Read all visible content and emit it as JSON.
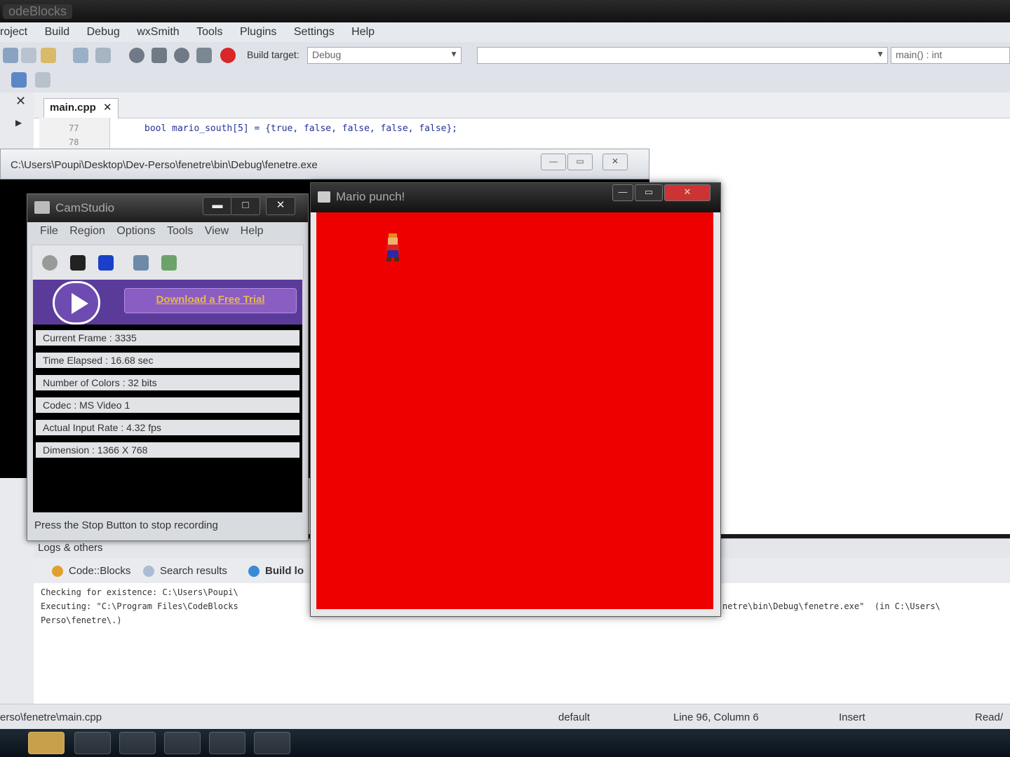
{
  "ide": {
    "title": "odeBlocks",
    "menu": [
      "roject",
      "Build",
      "Debug",
      "wxSmith",
      "Tools",
      "Plugins",
      "Settings",
      "Help"
    ],
    "build_target_label": "Build target:",
    "build_target_value": "Debug",
    "symbol_combo": "main() : int",
    "file_tab": "main.cpp",
    "line_numbers": [
      "77",
      "78"
    ],
    "code_line": "bool mario_south[5] = {true, false, false, false, false};"
  },
  "console": {
    "path": "C:\\Users\\Poupi\\Desktop\\Dev-Perso\\fenetre\\bin\\Debug\\fenetre.exe"
  },
  "camstudio": {
    "title": "CamStudio",
    "menu": [
      "File",
      "Region",
      "Options",
      "Tools",
      "View",
      "Help"
    ],
    "promo_button": "Download a Free Trial",
    "info": [
      "Current Frame : 3335",
      "Time Elapsed : 16.68 sec",
      "Number of Colors : 32 bits",
      "Codec : MS Video 1",
      "Actual Input Rate : 4.32 fps",
      "Dimension : 1366 X 768"
    ],
    "status": "Press the Stop Button to stop recording"
  },
  "mario_window": {
    "title": "Mario punch!",
    "background_color": "#ee0000"
  },
  "logs": {
    "header": "Logs & others",
    "tabs": [
      "Code::Blocks",
      "Search results",
      "Build lo"
    ],
    "lines": [
      "Checking for existence: C:\\Users\\Poupi\\",
      "Executing: \"C:\\Program Files\\CodeBlocks",
      "Perso\\fenetre\\.)"
    ],
    "line2_tail": "netre\\bin\\Debug\\fenetre.exe\"  (in C:\\Users\\"
  },
  "statusbar": {
    "file": "erso\\fenetre\\main.cpp",
    "encoding": "default",
    "position": "Line 96, Column 6",
    "mode": "Insert",
    "access": "Read/"
  }
}
